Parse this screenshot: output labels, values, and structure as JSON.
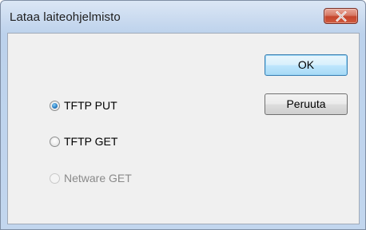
{
  "window": {
    "title": "Lataa laiteohjelmisto"
  },
  "buttons": {
    "ok_label": "OK",
    "cancel_label": "Peruuta"
  },
  "options": [
    {
      "label": "TFTP PUT",
      "checked": true,
      "enabled": true
    },
    {
      "label": "TFTP GET",
      "checked": false,
      "enabled": true
    },
    {
      "label": "Netware GET",
      "checked": false,
      "enabled": false
    }
  ],
  "colors": {
    "close_button": "#c5452c",
    "default_button_border": "#3c7fb1",
    "radio_selected": "#2c7fc4",
    "disabled_text": "#8a8a8a"
  },
  "icons": {
    "close": "close-icon"
  }
}
